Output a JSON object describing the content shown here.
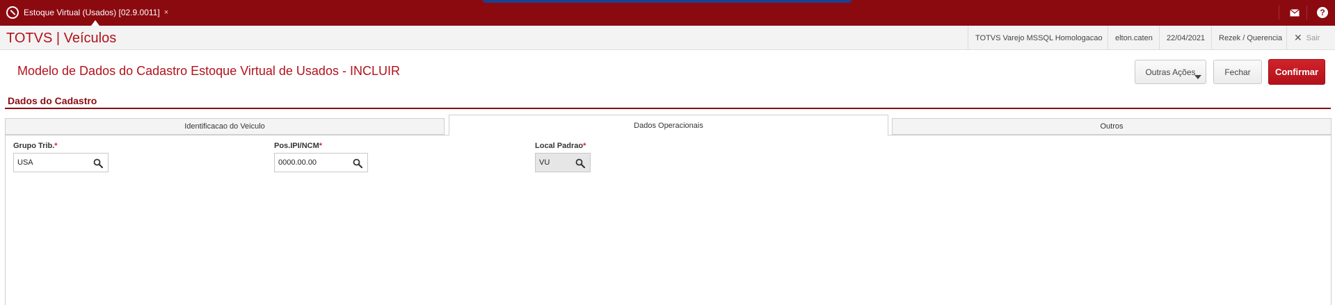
{
  "topbar": {
    "tab_label": "Estoque Virtual (Usados) [02.9.0011]",
    "tab_close": "×",
    "help_label": "?"
  },
  "header": {
    "brand": "TOTVS | Veículos",
    "environment": "TOTVS Varejo MSSQL Homologacao",
    "user": "elton.caten",
    "date": "22/04/2021",
    "branch": "Rezek / Querencia",
    "logout_label": "Sair"
  },
  "form": {
    "title": "Modelo de Dados do Cadastro Estoque Virtual de Usados - INCLUIR",
    "other_actions_label": "Outras Ações",
    "close_label": "Fechar",
    "confirm_label": "Confirmar"
  },
  "section": {
    "title": "Dados do Cadastro"
  },
  "tabs": [
    {
      "label": "Identificacao do Veiculo",
      "active": false
    },
    {
      "label": "Dados Operacionais",
      "active": true
    },
    {
      "label": "Outros",
      "active": false
    }
  ],
  "fields": {
    "grupo_trib": {
      "label": "Grupo Trib.",
      "value": "USA"
    },
    "pos_ipi_ncm": {
      "label": "Pos.IPI/NCM",
      "value": "0000.00.00"
    },
    "local_padrao": {
      "label": "Local Padrao",
      "value": "VU"
    }
  },
  "colors": {
    "brand_red": "#8b0a10",
    "accent_red": "#b3111b",
    "confirm_red": "#d0232b"
  }
}
